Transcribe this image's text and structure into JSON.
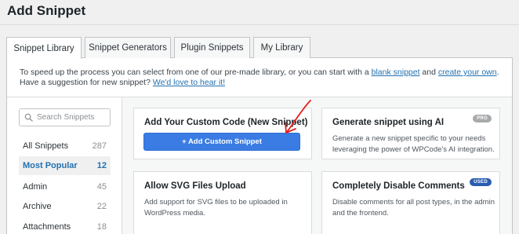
{
  "page": {
    "title": "Add Snippet"
  },
  "tabs": [
    {
      "label": "Snippet Library"
    },
    {
      "label": "Snippet Generators"
    },
    {
      "label": "Plugin Snippets"
    },
    {
      "label": "My Library"
    }
  ],
  "intro": {
    "text_before": "To speed up the process you can select from one of our pre-made library, or you can start with a ",
    "link_blank": "blank snippet",
    "text_and": " and ",
    "link_create": "create your own",
    "text_after": ". Have a suggestion for new snippet? ",
    "link_suggest": "We'd love to hear it!"
  },
  "search": {
    "placeholder": "Search Snippets",
    "value": "",
    "icon": "search-icon"
  },
  "categories": [
    {
      "label": "All Snippets",
      "count": "287"
    },
    {
      "label": "Most Popular",
      "count": "12"
    },
    {
      "label": "Admin",
      "count": "45"
    },
    {
      "label": "Archive",
      "count": "22"
    },
    {
      "label": "Attachments",
      "count": "18"
    }
  ],
  "cards": {
    "custom": {
      "title": "Add Your Custom Code (New Snippet)",
      "button": "+ Add Custom Snippet"
    },
    "ai": {
      "title": "Generate snippet using AI",
      "desc": "Generate a new snippet specific to your needs leveraging the power of WPCode's AI integration.",
      "badge": "PRO"
    },
    "svg": {
      "title": "Allow SVG Files Upload",
      "desc": "Add support for SVG files to be uploaded in WordPress media."
    },
    "comments": {
      "title": "Completely Disable Comments",
      "desc": "Disable comments for all post types, in the admin and the frontend.",
      "badge": "USED"
    }
  },
  "colors": {
    "accent": "#2271b1",
    "button": "#3a7ce3",
    "pro_badge": "#a7aaad",
    "used_badge": "#2a5db0",
    "annotation_arrow": "#e0201b"
  }
}
